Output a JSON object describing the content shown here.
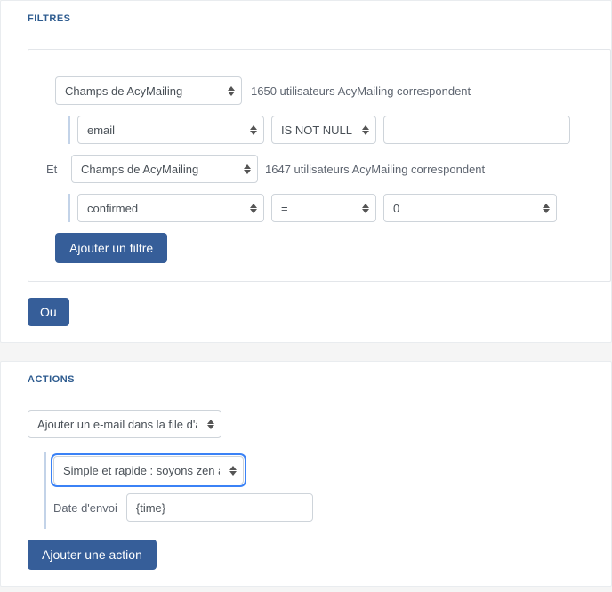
{
  "filtres": {
    "title": "FILTRES",
    "group1": {
      "source": "Champs de AcyMailing",
      "count_text": "1650 utilisateurs AcyMailing correspondent",
      "field": "email",
      "operator": "IS NOT NULL",
      "value": ""
    },
    "et_label": "Et",
    "group2": {
      "source": "Champs de AcyMailing",
      "count_text": "1647 utilisateurs AcyMailing correspondent",
      "field": "confirmed",
      "operator": "=",
      "value": "0"
    },
    "add_filter_label": "Ajouter un filtre",
    "ou_label": "Ou"
  },
  "actions": {
    "title": "ACTIONS",
    "type": "Ajouter un e-mail dans la file d'att",
    "email_select": "Simple et rapide : soyons zen ave",
    "date_label": "Date d'envoi",
    "date_value": "{time}",
    "add_action_label": "Ajouter une action"
  }
}
